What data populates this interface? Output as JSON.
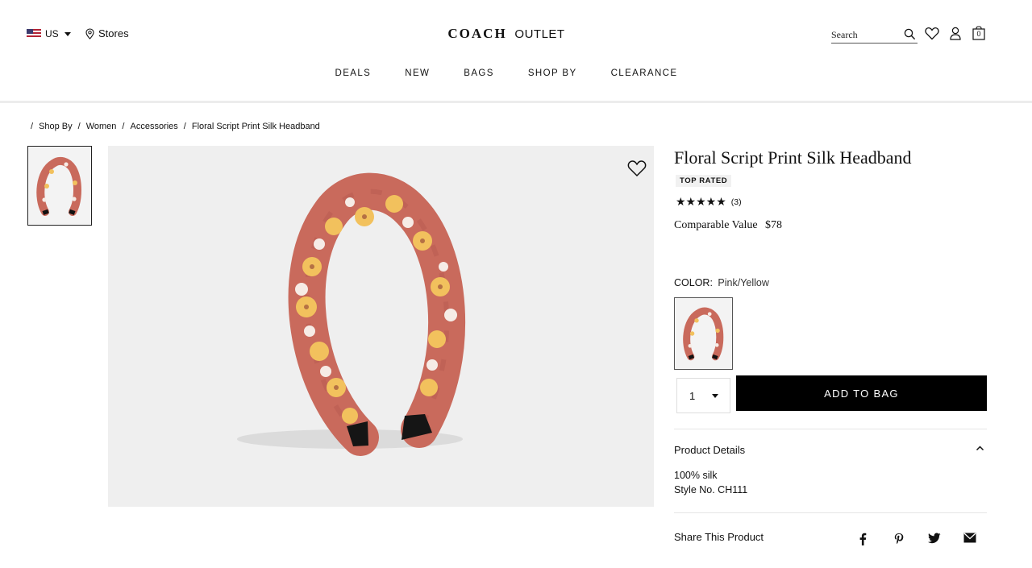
{
  "header": {
    "country_label": "US",
    "stores_label": "Stores",
    "brand": "COACH",
    "brand_suffix": "OUTLET",
    "search_placeholder": "Search",
    "bag_count": "0",
    "icons": [
      "search-icon",
      "heart-icon",
      "user-icon",
      "bag-icon",
      "location-pin-icon",
      "us-flag-icon"
    ]
  },
  "nav": {
    "items": [
      "DEALS",
      "NEW",
      "BAGS",
      "SHOP BY",
      "CLEARANCE"
    ]
  },
  "breadcrumb": [
    "Shop By",
    "Women",
    "Accessories",
    "Floral Script Print Silk Headband"
  ],
  "product": {
    "title": "Floral Script Print Silk Headband",
    "badge": "TOP RATED",
    "rating_stars": "★★★★★",
    "rating": 5,
    "review_count": "(3)",
    "price_label": "Comparable Value",
    "price_value": "$78",
    "color_label": "COLOR:",
    "color_value": "Pink/Yellow",
    "quantity": "1",
    "add_to_bag": "ADD TO BAG",
    "details_title": "Product Details",
    "details": [
      "100% silk",
      "Style No. CH111"
    ],
    "share_label": "Share This Product",
    "share_icons": [
      "facebook-icon",
      "pinterest-icon",
      "twitter-icon",
      "email-icon"
    ]
  },
  "colors": {
    "accent": "#000000",
    "headband_base": "#c96a5c",
    "flower_yellow": "#f2c15d",
    "flower_white": "#f6ece6",
    "image_bg": "#efefef"
  }
}
